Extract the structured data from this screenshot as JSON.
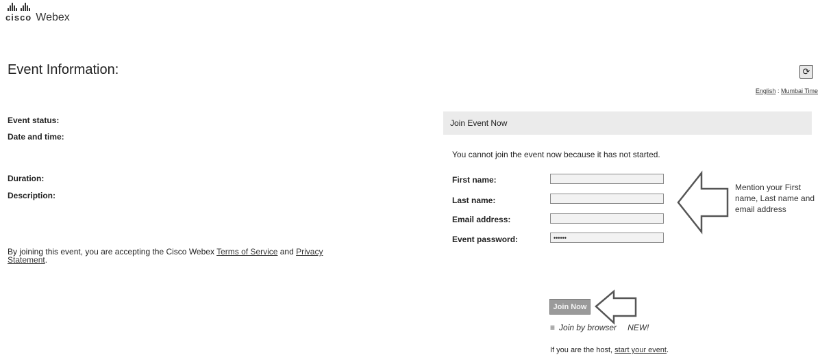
{
  "logo": {
    "brand": "cisco",
    "product": "Webex"
  },
  "page_title": "Event Information:",
  "refresh_icon": "refresh-icon",
  "lang": {
    "language": "English",
    "separator": ":",
    "timezone": "Mumbai Time"
  },
  "event_info": {
    "status_label": "Event status:",
    "datetime_label": "Date and time:",
    "duration_label": "Duration:",
    "description_label": "Description:"
  },
  "terms": {
    "prefix": "By joining this event, you are accepting the Cisco Webex ",
    "tos_link": "Terms of Service",
    "and": " and ",
    "privacy_link": "Privacy Statement",
    "suffix": "."
  },
  "join_panel": {
    "header": "Join Event Now",
    "notice": "You cannot join the event now because it has not started.",
    "fields": {
      "first_name": {
        "label": "First name:",
        "value": ""
      },
      "last_name": {
        "label": "Last name:",
        "value": ""
      },
      "email": {
        "label": "Email address:",
        "value": ""
      },
      "password": {
        "label": "Event password:",
        "value": "••••••"
      }
    },
    "join_button": "Join Now",
    "browser_link": "Join by browser",
    "new_badge": "NEW!",
    "host_prefix": "If you are the host, ",
    "host_link": "start your event",
    "host_suffix": "."
  },
  "annotation": {
    "text": "Mention your First name, Last name and email address"
  },
  "colors": {
    "panel_header_bg": "#ebebeb",
    "input_bg": "#f2f2f2",
    "button_bg": "#9a9a9a"
  }
}
